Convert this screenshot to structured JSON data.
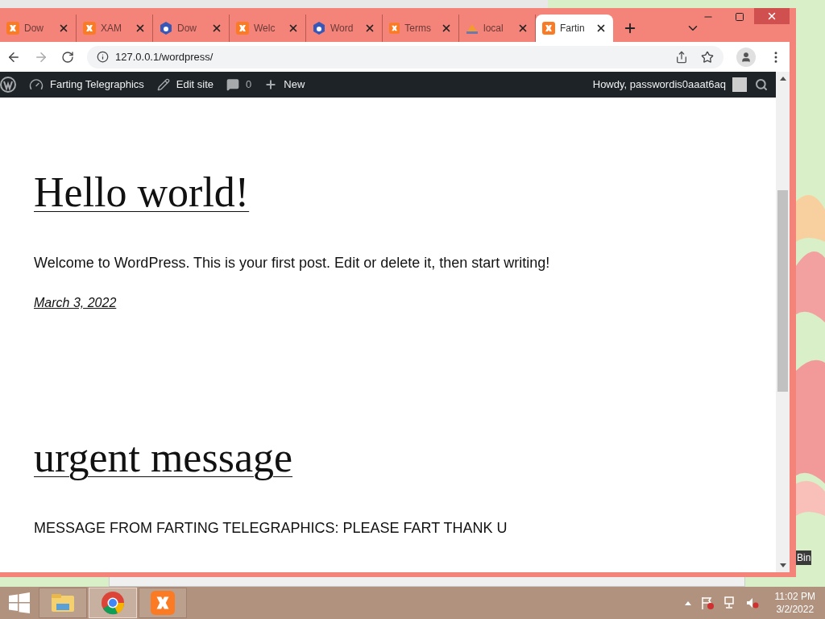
{
  "tabs": [
    {
      "title": "Dow",
      "kind": "xampp",
      "selected": false
    },
    {
      "title": "XAM",
      "kind": "xampp",
      "selected": false
    },
    {
      "title": "Dow",
      "kind": "hex",
      "selected": false
    },
    {
      "title": "Welc",
      "kind": "xampp",
      "selected": false
    },
    {
      "title": "Word",
      "kind": "hex",
      "selected": false
    },
    {
      "title": "Terms",
      "kind": "xampp",
      "selected": false
    },
    {
      "title": "local",
      "kind": "pma",
      "selected": false
    },
    {
      "title": "Fartin",
      "kind": "xampp",
      "selected": true
    }
  ],
  "address": "127.0.0.1/wordpress/",
  "admin_bar": {
    "site": "Farting Telegraphics",
    "edit": "Edit site",
    "comments": "0",
    "new": "New",
    "howdy": "Howdy, passwordis0aaat6aq"
  },
  "posts": [
    {
      "title": "Hello world!",
      "body": "Welcome to WordPress. This is your first post. Edit or delete it, then start writing!",
      "date": "March 3, 2022"
    },
    {
      "title": "urgent message",
      "body": "MESSAGE FROM FARTING TELEGRAPHICS: PLEASE FART THANK U"
    }
  ],
  "desktop_icon": "Bin",
  "taskbar": {
    "apps": [
      {
        "kind": "explorer",
        "selected": false
      },
      {
        "kind": "chrome",
        "selected": true
      },
      {
        "kind": "xampp",
        "selected": false
      }
    ],
    "time": "11:02 PM",
    "date": "3/2/2022"
  }
}
